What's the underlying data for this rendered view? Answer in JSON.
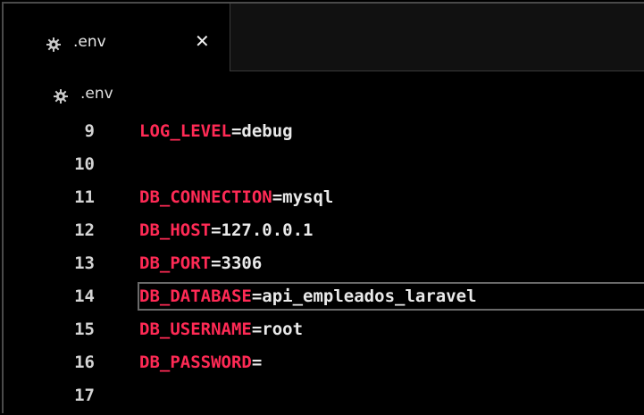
{
  "tab": {
    "label": ".env",
    "close": "✕"
  },
  "breadcrumb": {
    "label": ".env"
  },
  "lines": [
    {
      "num": "9",
      "key": "LOG_LEVEL",
      "eq": "=",
      "val": "debug"
    },
    {
      "num": "10",
      "key": "",
      "eq": "",
      "val": ""
    },
    {
      "num": "11",
      "key": "DB_CONNECTION",
      "eq": "=",
      "val": "mysql"
    },
    {
      "num": "12",
      "key": "DB_HOST",
      "eq": "=",
      "val": "127.0.0.1"
    },
    {
      "num": "13",
      "key": "DB_PORT",
      "eq": "=",
      "val": "3306"
    },
    {
      "num": "14",
      "key": "DB_DATABASE",
      "eq": "=",
      "val": "api_empleados_laravel"
    },
    {
      "num": "15",
      "key": "DB_USERNAME",
      "eq": "=",
      "val": "root"
    },
    {
      "num": "16",
      "key": "DB_PASSWORD",
      "eq": "=",
      "val": ""
    },
    {
      "num": "17",
      "key": "",
      "eq": "",
      "val": ""
    }
  ],
  "colors": {
    "key": "#ff2a55",
    "value": "#eaeaea",
    "background": "#000000"
  },
  "icons": {
    "file": "gear-icon",
    "close": "close-icon"
  }
}
